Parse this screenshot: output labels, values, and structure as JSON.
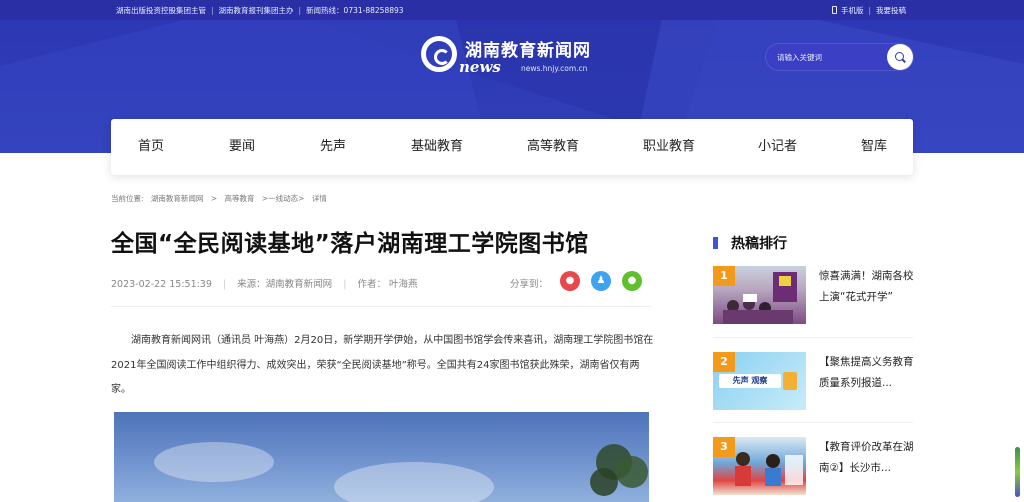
{
  "topbar": {
    "left": [
      "湖南出版投资控股集团主管",
      "湖南教育报刊集团主办",
      "新闻热线：0731-88258893"
    ],
    "right": [
      "手机版",
      "我要投稿"
    ]
  },
  "logo": {
    "name_cn": "湖南教育新闻网",
    "news": "news",
    "url": "news.hnjy.com.cn"
  },
  "search": {
    "placeholder": "请输入关键词"
  },
  "nav": [
    "首页",
    "要闻",
    "先声",
    "基础教育",
    "高等教育",
    "职业教育",
    "小记者",
    "智库"
  ],
  "breadcrumb": [
    "当前位置:",
    "湖南教育新闻网",
    ">",
    "高等教育",
    ">一线动态>",
    "详情"
  ],
  "article": {
    "title": "全国“全民阅读基地”落户湖南理工学院图书馆",
    "date": "2023-02-22 15:51:39",
    "source": "来源：湖南教育新闻网",
    "author": "作者：  叶海燕",
    "share_label": "分享到：",
    "body": "湖南教育新闻网讯（通讯员 叶海燕）2月20日，新学期开学伊始，从中国图书馆学会传来喜讯，湖南理工学院图书馆在2021年全国阅读工作中组织得力、成效突出，荣获“全民阅读基地”称号。全国共有24家图书馆获此殊荣，湖南省仅有两家。"
  },
  "sidebar": {
    "title": "热稿排行",
    "items": [
      {
        "rank": "1",
        "text": "惊喜满满！湖南各校上演“花式开学”"
      },
      {
        "rank": "2",
        "text": "【聚焦提高义务教育质量系列报道..."
      },
      {
        "rank": "3",
        "text": "【教育评价改革在湖南②】长沙市..."
      }
    ],
    "thumb2_caption": "先声 观察"
  },
  "colors": {
    "header": "#2e3bb6",
    "accent": "#3d55d6",
    "rank": "#f39a1b"
  },
  "icons": [
    "phone-icon",
    "search-icon",
    "weibo-icon",
    "qq-icon",
    "wechat-icon"
  ]
}
